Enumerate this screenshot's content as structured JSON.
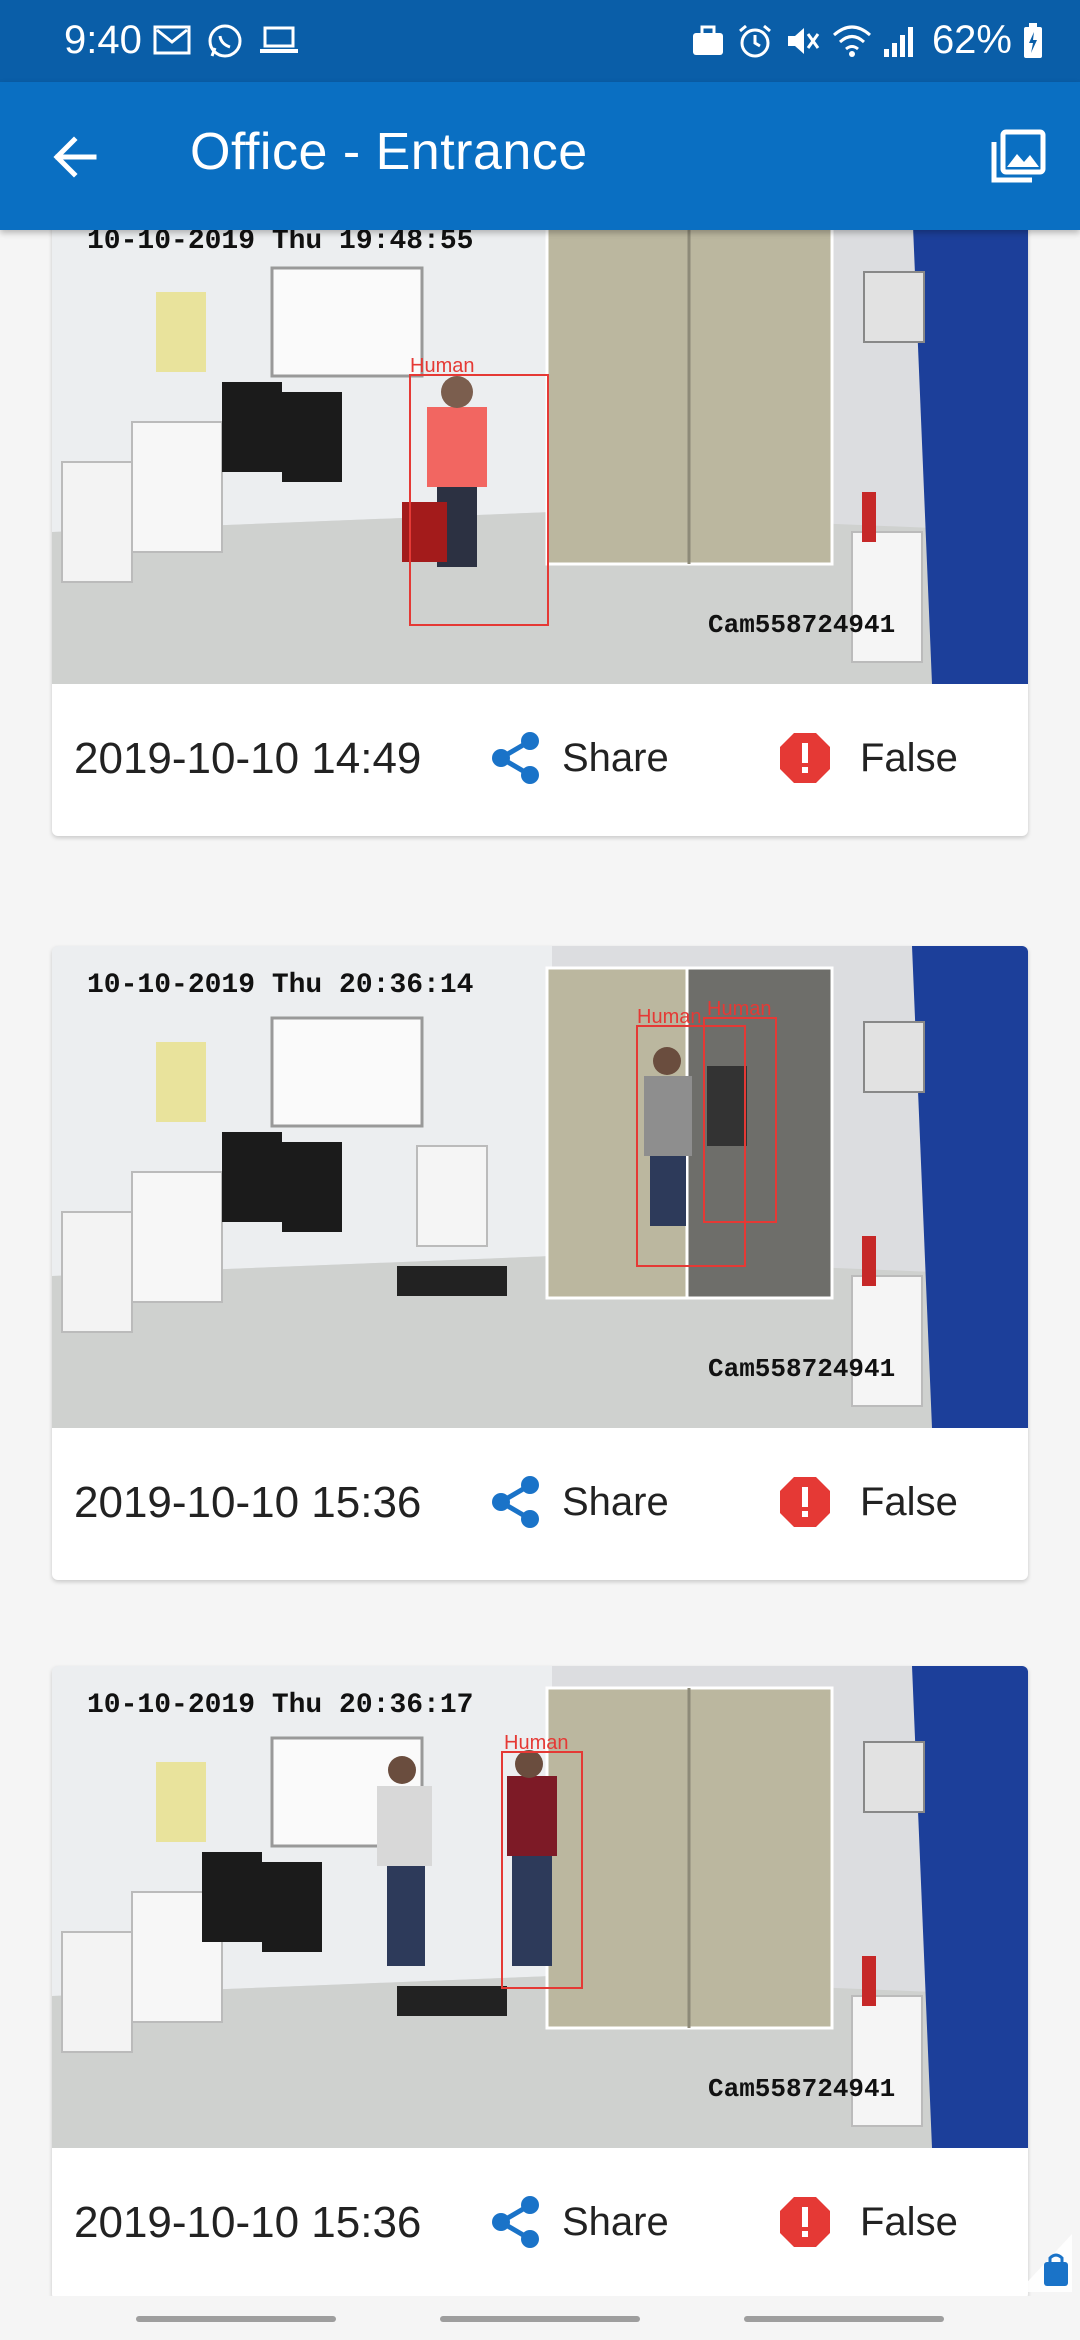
{
  "status_bar": {
    "time": "9:40",
    "left_icons": [
      "gmail-icon",
      "whatsapp-icon",
      "laptop-icon"
    ],
    "right_icons": [
      "briefcase-icon",
      "alarm-icon",
      "mute-icon",
      "wifi-icon",
      "signal-icon",
      "battery-icon"
    ],
    "battery": "62%"
  },
  "app_bar": {
    "title": "Office - Entrance",
    "back_icon": "arrow-back-icon",
    "gallery_icon": "gallery-icon"
  },
  "events": [
    {
      "camera_timestamp": "10-10-2019 Thu 19:48:55",
      "camera_id": "Cam558724941",
      "detections": [
        "Human"
      ],
      "timestamp": "2019-10-10 14:49",
      "share_label": "Share",
      "status_label": "False"
    },
    {
      "camera_timestamp": "10-10-2019 Thu 20:36:14",
      "camera_id": "Cam558724941",
      "detections": [
        "Human",
        "Human"
      ],
      "timestamp": "2019-10-10 15:36",
      "share_label": "Share",
      "status_label": "False"
    },
    {
      "camera_timestamp": "10-10-2019 Thu 20:36:17",
      "camera_id": "Cam558724941",
      "detections": [
        "Human"
      ],
      "timestamp": "2019-10-10 15:36",
      "share_label": "Share",
      "status_label": "False"
    }
  ],
  "colors": {
    "status_bar": "#0a5ea8",
    "app_bar": "#0a6fc2",
    "share_icon": "#1a73c8",
    "false_badge": "#e53935",
    "detection_box": "#e53935"
  }
}
